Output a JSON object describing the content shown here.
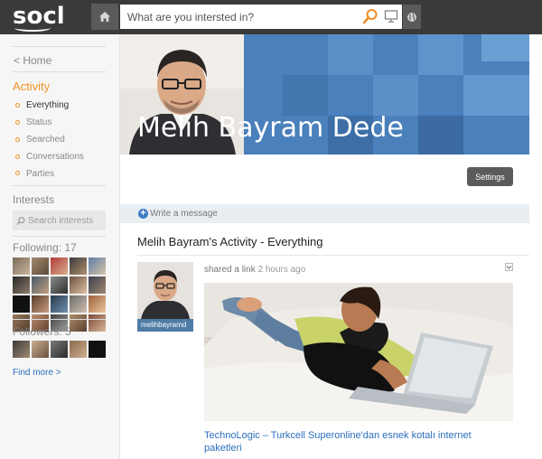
{
  "header": {
    "logo": "socl",
    "search_placeholder": "What are you intersted in?"
  },
  "sidebar": {
    "home_link": "< Home",
    "activity_title": "Activity",
    "nav_items": [
      {
        "label": "Everything"
      },
      {
        "label": "Status"
      },
      {
        "label": "Searched"
      },
      {
        "label": "Conversations"
      },
      {
        "label": "Parties"
      }
    ],
    "interests_title": "Interests",
    "interests_search_placeholder": "Search interests",
    "following_title": "Following: 17",
    "followers_title": "Followers: 5",
    "find_more": "Find more >"
  },
  "profile": {
    "name": "Melih Bayram Dede",
    "settings_label": "Settings"
  },
  "activity": {
    "write_message": "Write a message",
    "heading": "Melih Bayram's Activity - Everything",
    "post": {
      "poster_name": "melihbayramd",
      "action": "shared a link",
      "time": "2 hours ago",
      "link_title": "TechnoLogic – Turkcell Superonline'dan esnek kotalı internet paketleri"
    }
  },
  "colors": {
    "accent_orange": "#f39325",
    "link_blue": "#2a6ebb",
    "topbar": "#3a3a3a",
    "cover_blue": "#4a7fb8"
  }
}
